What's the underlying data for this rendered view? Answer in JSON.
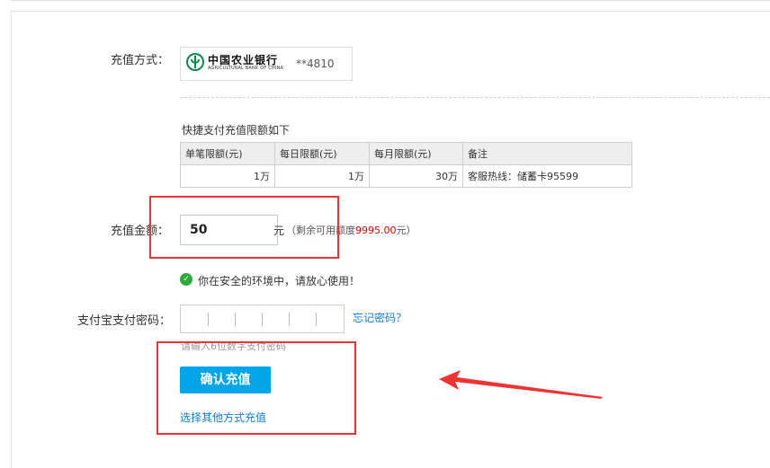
{
  "payment_method": {
    "label": "充值方式：",
    "bank_name_cn": "中国农业银行",
    "bank_name_en": "AGRICULTURAL BANK OF CHINA",
    "card_suffix": "**4810"
  },
  "limits": {
    "title": "快捷支付充值限额如下",
    "headers": [
      "单笔限额(元)",
      "每日限额(元)",
      "每月限额(元)",
      "备注"
    ],
    "row": [
      "1万",
      "1万",
      "30万",
      "客服热线：储蓄卡95599"
    ]
  },
  "amount": {
    "label": "充值金额：",
    "value": "50",
    "unit": "元",
    "remaining_prefix": "（剩余可用额度",
    "remaining_value": "9995.00",
    "remaining_suffix": "元）"
  },
  "security": {
    "message": "你在安全的环境中，请放心使用！"
  },
  "password": {
    "label": "支付宝支付密码：",
    "forgot": "忘记密码？",
    "hint": "请输入6位数字支付密码"
  },
  "actions": {
    "confirm": "确认充值",
    "other_method": "选择其他方式充值"
  },
  "colors": {
    "primary_button": "#00a6e8",
    "link": "#0e7fd0",
    "highlight": "#ee3333",
    "safe": "#2eaa3a"
  }
}
